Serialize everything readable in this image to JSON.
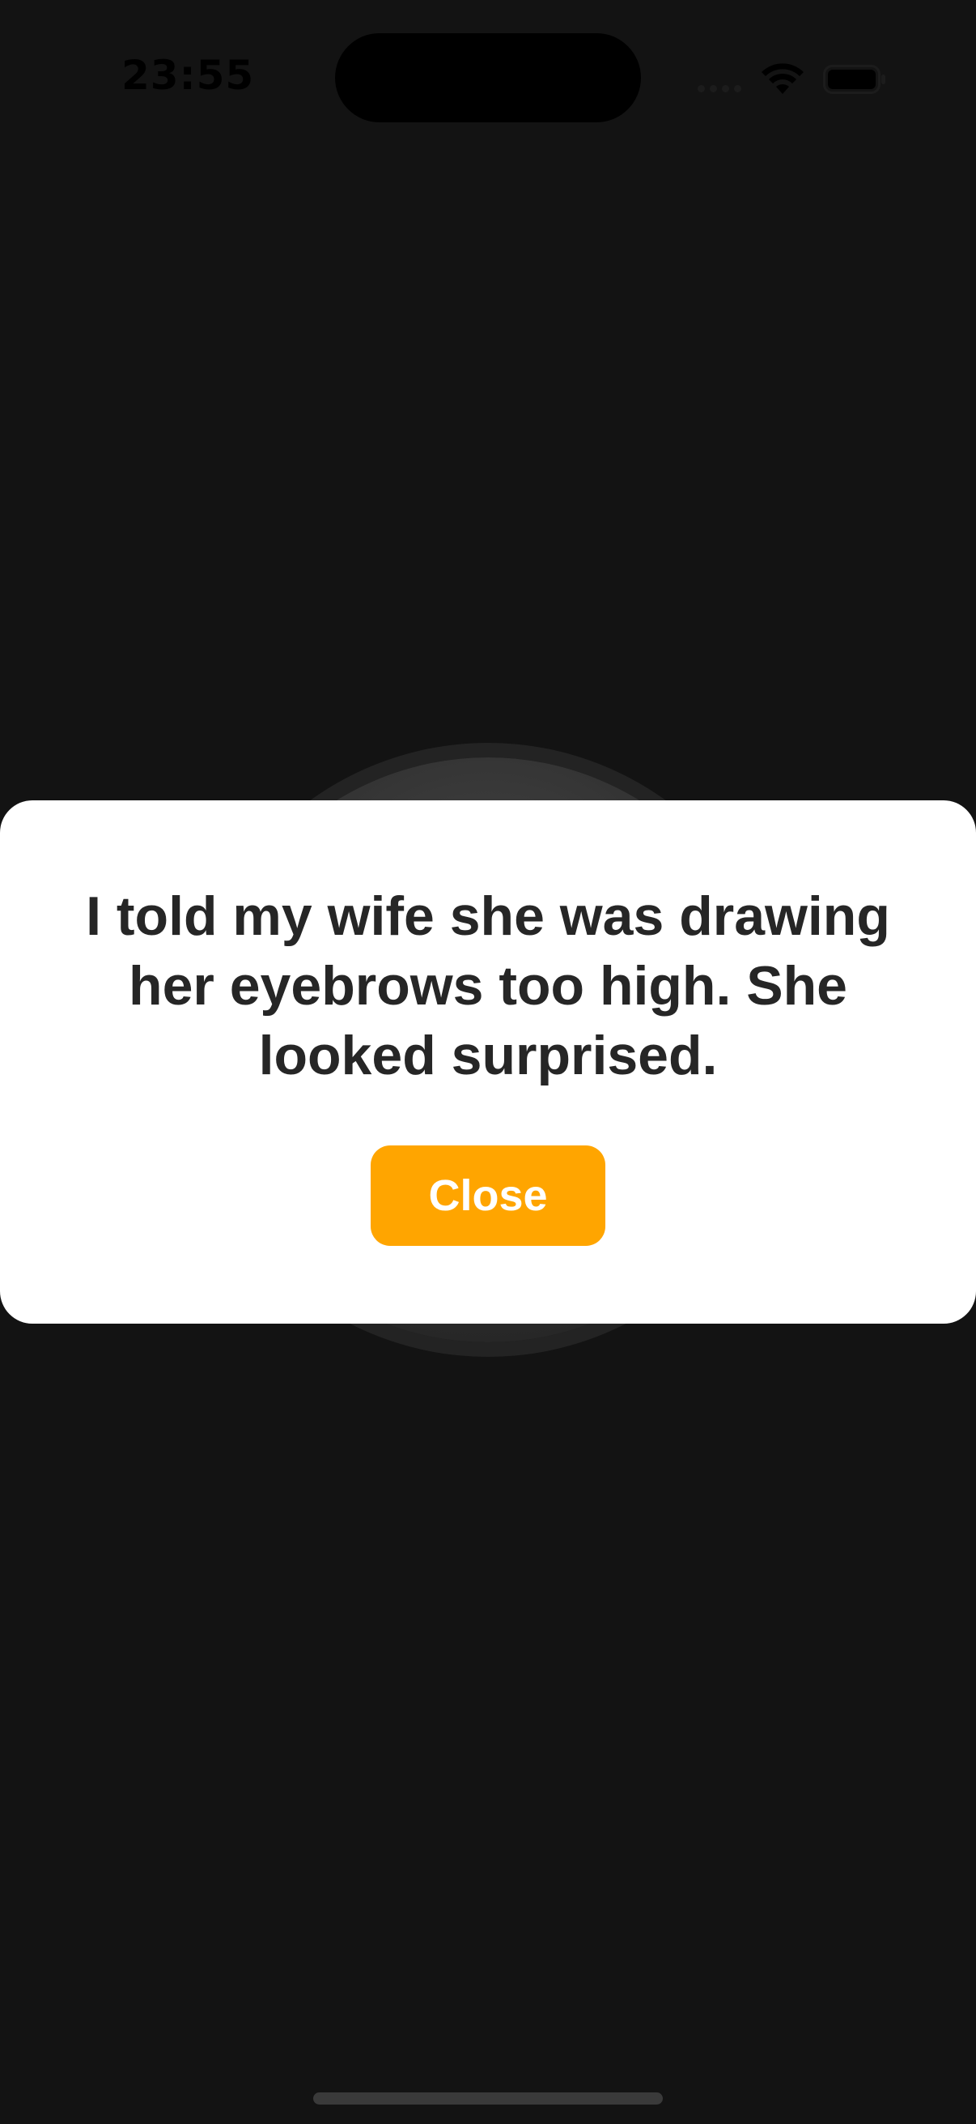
{
  "status_bar": {
    "time": "23:55",
    "icons": [
      "signal-icon",
      "wifi-icon",
      "battery-icon"
    ]
  },
  "modal": {
    "message": "I told my wife she was drawing her eyebrows too high. She looked surprised.",
    "close_label": "Close"
  },
  "colors": {
    "background": "#131313",
    "modal_background": "#ffffff",
    "message_text": "#262626",
    "accent": "#ffa500"
  }
}
